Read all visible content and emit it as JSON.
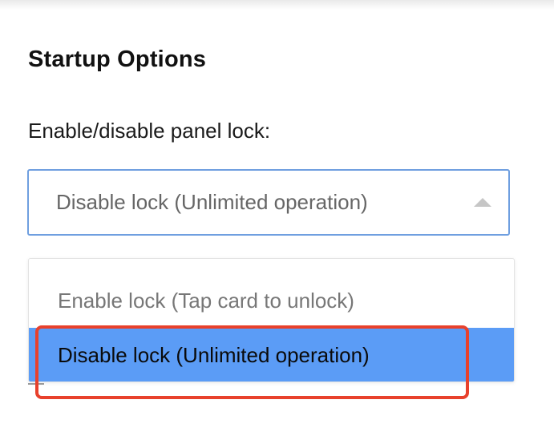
{
  "section": {
    "title": "Startup Options",
    "lock_label": "Enable/disable panel lock:"
  },
  "select": {
    "value": "Disable lock (Unlimited operation)",
    "options": [
      {
        "label": "Enable lock (Tap card to unlock)",
        "selected": false
      },
      {
        "label": "Disable lock (Unlimited operation)",
        "selected": true
      }
    ]
  },
  "colors": {
    "accent": "#6f9fe0",
    "selected_option": "#5b9cf6",
    "annotation": "#e8412c"
  }
}
